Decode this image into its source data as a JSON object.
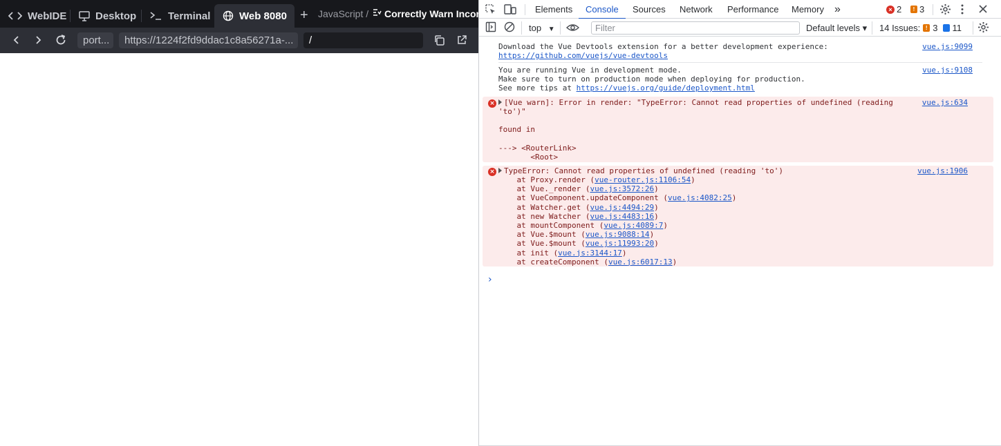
{
  "ide": {
    "tabs": [
      {
        "label": "WebIDE",
        "icon": "code-icon"
      },
      {
        "label": "Desktop",
        "icon": "monitor-icon"
      },
      {
        "label": "Terminal",
        "icon": "terminal-icon"
      },
      {
        "label": "Web 8080",
        "icon": "globe-icon",
        "active": true
      }
    ],
    "add_tab": "+",
    "breadcrumb": "JavaScript  /",
    "title": "Correctly Warn Incorre",
    "toolbar": {
      "port_pill": "port...",
      "url": "https://1224f2fd9ddac1c8a56271a-...",
      "path": "/"
    }
  },
  "devtools": {
    "tabs": [
      "Elements",
      "Console",
      "Sources",
      "Network",
      "Performance",
      "Memory"
    ],
    "active_tab": "Console",
    "more_tabs": "»",
    "error_count": "2",
    "warning_count": "3",
    "context": "top",
    "filter_placeholder": "Filter",
    "levels": "Default levels ▾",
    "issues_label": "14 Issues:",
    "issues_warn": "3",
    "issues_info": "11",
    "colors": {
      "accent": "#1a56c8",
      "error": "#d93025",
      "error_bg": "#fcebeb",
      "warning": "#e37400"
    }
  },
  "console": {
    "msg1": {
      "line1": "Download the Vue Devtools extension for a better development experience:",
      "link": "https://github.com/vuejs/vue-devtools",
      "src": "vue.js:9099"
    },
    "msg2": {
      "line1": "You are running Vue in development mode.",
      "line2": "Make sure to turn on production mode when deploying for production.",
      "line3_prefix": "See more tips at ",
      "link": "https://vuejs.org/guide/deployment.html",
      "src": "vue.js:9108"
    },
    "msg3": {
      "line1": "[Vue warn]: Error in render: \"TypeError: Cannot read properties of undefined (reading",
      "line2": "'to')\"",
      "line3": "found in",
      "line4": "---> <RouterLink>",
      "line5": "       <Root>",
      "src": "vue.js:634"
    },
    "msg4": {
      "head": "TypeError: Cannot read properties of undefined (reading 'to')",
      "src": "vue.js:1906",
      "stack": [
        {
          "fn": "    at Proxy.render (",
          "loc": "vue-router.js:1106:54"
        },
        {
          "fn": "    at Vue._render (",
          "loc": "vue.js:3572:26"
        },
        {
          "fn": "    at VueComponent.updateComponent (",
          "loc": "vue.js:4082:25"
        },
        {
          "fn": "    at Watcher.get (",
          "loc": "vue.js:4494:29"
        },
        {
          "fn": "    at new Watcher (",
          "loc": "vue.js:4483:16"
        },
        {
          "fn": "    at mountComponent (",
          "loc": "vue.js:4089:7"
        },
        {
          "fn": "    at Vue.$mount (",
          "loc": "vue.js:9088:14"
        },
        {
          "fn": "    at Vue.$mount (",
          "loc": "vue.js:11993:20"
        },
        {
          "fn": "    at init (",
          "loc": "vue.js:3144:17"
        },
        {
          "fn": "    at createComponent (",
          "loc": "vue.js:6017:13"
        }
      ]
    },
    "prompt": "›"
  }
}
